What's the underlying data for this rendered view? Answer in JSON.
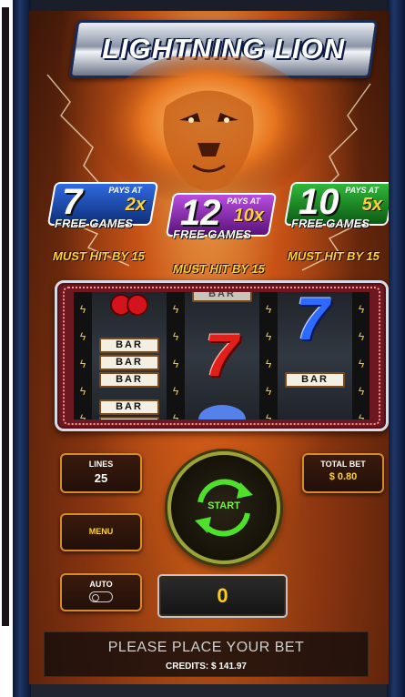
{
  "game": {
    "title": "LIGHTNING LION"
  },
  "bonuses": [
    {
      "games": "7",
      "pays_label": "PAYS AT",
      "multiplier": "2x",
      "free_label": "FREE GAMES",
      "must_hit": "MUST HIT BY 15",
      "color": "#1d4fb8"
    },
    {
      "games": "12",
      "pays_label": "PAYS AT",
      "multiplier": "10x",
      "free_label": "FREE GAMES",
      "must_hit": "MUST HIT BY 15",
      "color": "#8f2fb5"
    },
    {
      "games": "10",
      "pays_label": "PAYS AT",
      "multiplier": "5x",
      "free_label": "FREE GAMES",
      "must_hit": "MUST HIT BY 15",
      "color": "#1e8f2a"
    }
  ],
  "reels": {
    "symbols": {
      "bar": "BAR",
      "seven": "7"
    },
    "reel_1": [
      "cherry",
      "triple-bar",
      "double-bar"
    ],
    "reel_2": [
      "single-bar",
      "red-seven",
      "blue-seven-partial"
    ],
    "reel_3": [
      "blue-seven",
      "single-bar"
    ]
  },
  "controls": {
    "lines_label": "LINES",
    "lines_value": "25",
    "total_bet_label": "TOTAL BET",
    "total_bet_value": "$ 0.80",
    "menu_label": "MENU",
    "start_label": "START",
    "auto_label": "AUTO",
    "win_value": "0"
  },
  "status": {
    "message": "PLEASE PLACE YOUR BET",
    "credits": "CREDITS: $ 141.97"
  },
  "colors": {
    "accent_gold": "#ffd233",
    "start_green": "#7cf04a"
  }
}
